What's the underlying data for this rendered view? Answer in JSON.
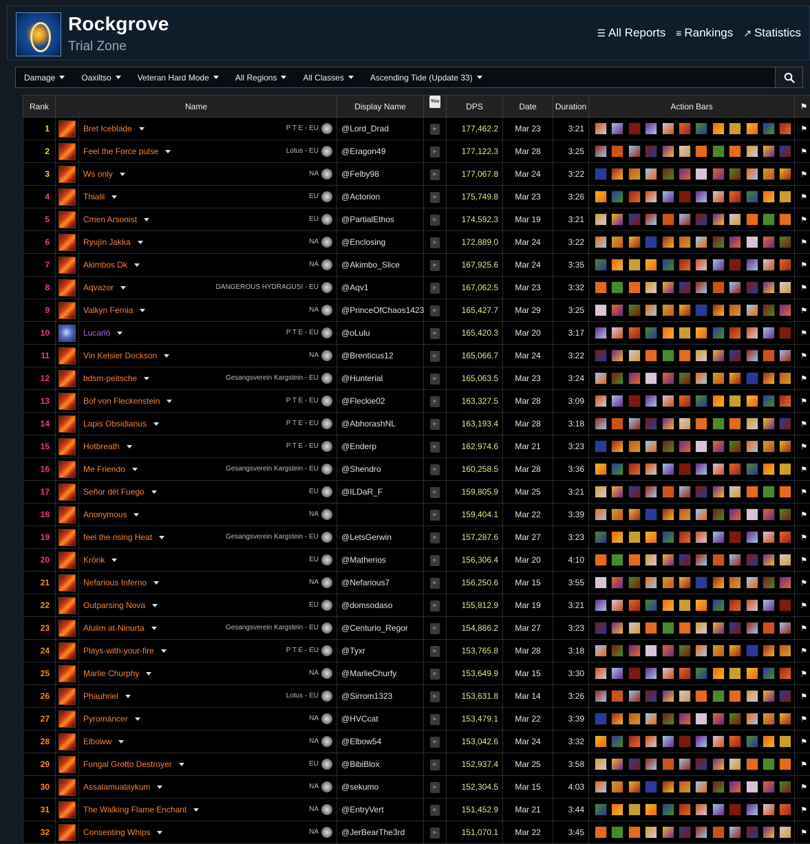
{
  "header": {
    "title": "Rockgrove",
    "subtitle": "Trial Zone",
    "nav": [
      {
        "label": "All Reports",
        "icon": "list-icon"
      },
      {
        "label": "Rankings",
        "icon": "bars-icon"
      },
      {
        "label": "Statistics",
        "icon": "chart-line-icon"
      }
    ]
  },
  "filters": [
    "Damage",
    "Oaxiltso",
    "Veteran Hard Mode",
    "All Regions",
    "All Classes",
    "Ascending Tide (Update 33)"
  ],
  "table": {
    "headers": {
      "rank": "Rank",
      "name": "Name",
      "display_name": "Display Name",
      "youtube": "You Tube",
      "dps": "DPS",
      "date": "Date",
      "duration": "Duration",
      "action_bars": "Action Bars"
    },
    "rows": [
      {
        "rank": "1",
        "name": "Bret Iceblade",
        "guild": "P T E - EU",
        "display": "@Lord_Drad",
        "dps": "177,462.2",
        "date": "Mar 23",
        "duration": "3:21"
      },
      {
        "rank": "2",
        "name": "Feel the Force pulse",
        "guild": "Lotus - EU",
        "display": "@Eragon49",
        "dps": "177,122.3",
        "date": "Mar 28",
        "duration": "3:25"
      },
      {
        "rank": "3",
        "name": "Ws only",
        "guild": "NA",
        "display": "@Felby98",
        "dps": "177,067.8",
        "date": "Mar 24",
        "duration": "3:22"
      },
      {
        "rank": "4",
        "name": "Thialil",
        "guild": "EU",
        "display": "@Actorion",
        "dps": "175,749.8",
        "date": "Mar 23",
        "duration": "3:26"
      },
      {
        "rank": "5",
        "name": "Cmen Arsonist",
        "guild": "EU",
        "display": "@PartialEthos",
        "dps": "174,592.3",
        "date": "Mar 19",
        "duration": "3:21"
      },
      {
        "rank": "6",
        "name": "Ryujín Jakka",
        "guild": "NA",
        "display": "@Enclosing",
        "dps": "172,889.0",
        "date": "Mar 24",
        "duration": "3:22"
      },
      {
        "rank": "7",
        "name": "Akimbos Dk",
        "guild": "NA",
        "display": "@Akimbo_Slice",
        "dps": "167,925.6",
        "date": "Mar 24",
        "duration": "3:35"
      },
      {
        "rank": "8",
        "name": "Aqvazor",
        "guild": "DANGEROUS HYDRAGUSI - EU",
        "display": "@Aqv1",
        "dps": "167,062.5",
        "date": "Mar 23",
        "duration": "3:32"
      },
      {
        "rank": "9",
        "name": "Valkyn Fernia",
        "guild": "NA",
        "display": "@PrinceOfChaos1423",
        "dps": "165,427.7",
        "date": "Mar 29",
        "duration": "3:25"
      },
      {
        "rank": "10",
        "name": "Lucarió",
        "guild": "P T E - EU",
        "display": "@oLulu",
        "dps": "165,420.3",
        "date": "Mar 20",
        "duration": "3:17",
        "purple": true
      },
      {
        "rank": "11",
        "name": "Vin Kelsier Dockson",
        "guild": "NA",
        "display": "@Brenticus12",
        "dps": "165,066.7",
        "date": "Mar 24",
        "duration": "3:22"
      },
      {
        "rank": "12",
        "name": "bdsm-peitsche",
        "guild": "Gesangsverein Kargstein - EU",
        "display": "@Hunterial",
        "dps": "165,063.5",
        "date": "Mar 23",
        "duration": "3:24"
      },
      {
        "rank": "13",
        "name": "Bof von Fleckenstein",
        "guild": "P T E - EU",
        "display": "@Fleckie02",
        "dps": "163,327.5",
        "date": "Mar 28",
        "duration": "3:09"
      },
      {
        "rank": "14",
        "name": "Lapis Obsidianus",
        "guild": "P T E - EU",
        "display": "@AbhorashNL",
        "dps": "163,193.4",
        "date": "Mar 28",
        "duration": "3:18"
      },
      {
        "rank": "15",
        "name": "Hotbreath",
        "guild": "P T E - EU",
        "display": "@Enderp",
        "dps": "162,974.6",
        "date": "Mar 21",
        "duration": "3:23"
      },
      {
        "rank": "16",
        "name": "Me Friendo",
        "guild": "Gesangsverein Kargstein - EU",
        "display": "@Shendro",
        "dps": "160,258.5",
        "date": "Mar 28",
        "duration": "3:36"
      },
      {
        "rank": "17",
        "name": "Señor dél Fuego",
        "guild": "EU",
        "display": "@ILDaR_F",
        "dps": "159,805.9",
        "date": "Mar 25",
        "duration": "3:21"
      },
      {
        "rank": "18",
        "name": "Anonymous",
        "guild": "NA",
        "display": "",
        "dps": "159,404.1",
        "date": "Mar 22",
        "duration": "3:39"
      },
      {
        "rank": "19",
        "name": "feel the rising Heat",
        "guild": "Gesangsverein Kargstein - EU",
        "display": "@LetsGerwin",
        "dps": "157,287.6",
        "date": "Mar 27",
        "duration": "3:23"
      },
      {
        "rank": "20",
        "name": "Krônk",
        "guild": "EU",
        "display": "@Matherios",
        "dps": "156,306.4",
        "date": "Mar 20",
        "duration": "4:10"
      },
      {
        "rank": "21",
        "name": "Nefarious Inferno",
        "guild": "NA",
        "display": "@Nefarious7",
        "dps": "156,250.6",
        "date": "Mar 15",
        "duration": "3:55"
      },
      {
        "rank": "22",
        "name": "Outparsing Nova",
        "guild": "EU",
        "display": "@domsodaso",
        "dps": "155,812.9",
        "date": "Mar 19",
        "duration": "3:21"
      },
      {
        "rank": "23",
        "name": "Alulim at-Ninurta",
        "guild": "Gesangsverein Kargstein - EU",
        "display": "@Centurio_Regor",
        "dps": "154,886.2",
        "date": "Mar 27",
        "duration": "3:23"
      },
      {
        "rank": "24",
        "name": "Plays-with-your-fire",
        "guild": "P T E - EU",
        "display": "@Tyxr",
        "dps": "153,765.8",
        "date": "Mar 28",
        "duration": "3:18"
      },
      {
        "rank": "25",
        "name": "Marlie Churphy",
        "guild": "NA",
        "display": "@MarlieChurfy",
        "dps": "153,649.9",
        "date": "Mar 15",
        "duration": "3:30"
      },
      {
        "rank": "26",
        "name": "Phauhriel",
        "guild": "Lotus - EU",
        "display": "@Sirrom1323",
        "dps": "153,631.8",
        "date": "Mar 14",
        "duration": "3:26"
      },
      {
        "rank": "27",
        "name": "Pyrománcer",
        "guild": "NA",
        "display": "@HVCcat",
        "dps": "153,479.1",
        "date": "Mar 22",
        "duration": "3:39"
      },
      {
        "rank": "28",
        "name": "Elboww",
        "guild": "NA",
        "display": "@Elbow54",
        "dps": "153,042.6",
        "date": "Mar 24",
        "duration": "3:32"
      },
      {
        "rank": "29",
        "name": "Fungal Grotto Destroyer",
        "guild": "EU",
        "display": "@BibiBlox",
        "dps": "152,937.4",
        "date": "Mar 25",
        "duration": "3:58"
      },
      {
        "rank": "30",
        "name": "Assalamualaykum",
        "guild": "NA",
        "display": "@sekumo",
        "dps": "152,304.5",
        "date": "Mar 15",
        "duration": "4:03"
      },
      {
        "rank": "31",
        "name": "The Walking Flame Enchant",
        "guild": "NA",
        "display": "@EntryVert",
        "dps": "151,452.9",
        "date": "Mar 21",
        "duration": "3:44"
      },
      {
        "rank": "32",
        "name": "Consenting Whips",
        "guild": "NA",
        "display": "@JerBearThe3rd",
        "dps": "151,070.1",
        "date": "Mar 22",
        "duration": "3:45"
      }
    ]
  },
  "colors": {
    "rank_top": "#f2d72e",
    "rank_high": "#ff8c1a",
    "rank_mid": "#e8408a",
    "player_orange": "#f2843a",
    "player_purple": "#a868e8",
    "dps": "#d6ec8e"
  },
  "skill_palette": [
    "#c8541a",
    "#e86a12",
    "#7a1a10",
    "#f3b52a",
    "#d8c4d6",
    "#9a2618",
    "#4a8a2a",
    "#9fc4e8",
    "#c9a030",
    "#6a2a8a",
    "#2a3a9a",
    "#e06a2a"
  ]
}
